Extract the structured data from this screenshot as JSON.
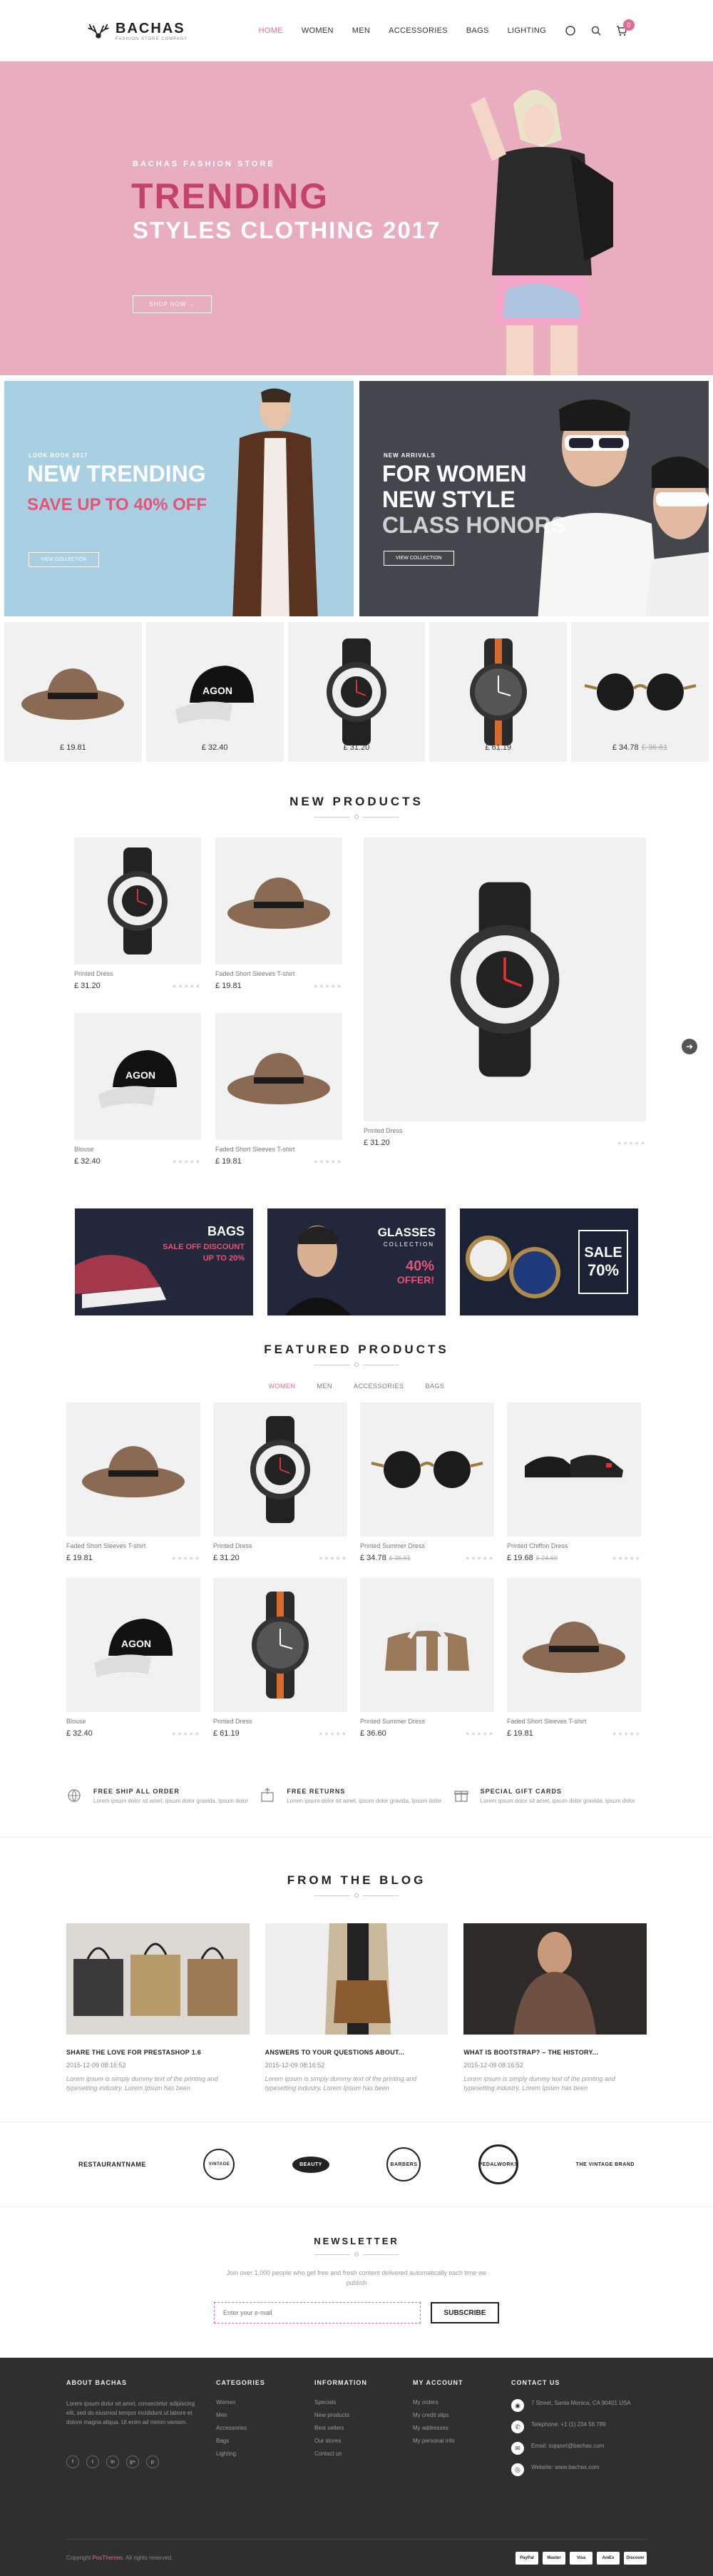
{
  "header": {
    "logo_name": "BACHAS",
    "logo_tag": "FASHION STORE COMPANY",
    "nav": [
      "HOME",
      "WOMEN",
      "MEN",
      "ACCESSORIES",
      "BAGS",
      "LIGHTING"
    ],
    "cart_count": "0"
  },
  "hero": {
    "kicker": "BACHAS FASHION STORE",
    "title": "TRENDING",
    "subtitle": "STYLES CLOTHING 2017",
    "button": "SHOP NOW →"
  },
  "banners": [
    {
      "kicker": "LOOK BOOK 2017",
      "title": "NEW TRENDING",
      "accent": "SAVE UP TO 40% OFF",
      "button": "VIEW COLLECTION"
    },
    {
      "kicker": "NEW ARRIVALS",
      "title": "FOR WOMEN",
      "lines": [
        "NEW STYLE",
        "CLASS HONORS"
      ],
      "button": "VIEW COLLECTION"
    }
  ],
  "strip": [
    {
      "type": "hat",
      "price": "£ 19.81",
      "old": ""
    },
    {
      "type": "cap",
      "price": "£ 32.40",
      "old": ""
    },
    {
      "type": "watch-red",
      "price": "£ 31.20",
      "old": ""
    },
    {
      "type": "watch-orange",
      "price": "£ 61.19",
      "old": ""
    },
    {
      "type": "sunglasses",
      "price": "£ 34.78",
      "old": "£ 36.61"
    }
  ],
  "new_products": {
    "title": "NEW PRODUCTS",
    "items": [
      {
        "name": "Printed Dress",
        "price": "£ 31.20",
        "type": "watch-red"
      },
      {
        "name": "Faded Short Sleeves T-shirt",
        "price": "£ 19.81",
        "type": "hat"
      },
      {
        "name": "Blouse",
        "price": "£ 32.40",
        "type": "cap"
      },
      {
        "name": "Faded Short Sleeves T-shirt",
        "price": "£ 19.81",
        "type": "hat"
      },
      {
        "name": "Printed Dress",
        "price": "£ 31.20",
        "type": "watch-red"
      }
    ]
  },
  "promos": [
    {
      "title": "BAGS",
      "line1": "SALE OFF DISCOUNT",
      "line2": "UP TO 20%"
    },
    {
      "title": "GLASSES",
      "sub": "COLLECTION",
      "percent": "40%",
      "offer": "OFFER!"
    },
    {
      "title": "SALE",
      "percent": "70%"
    }
  ],
  "featured": {
    "title": "FEATURED PRODUCTS",
    "tabs": [
      "WOMEN",
      "MEN",
      "ACCESSORIES",
      "BAGS"
    ],
    "items": [
      {
        "name": "Faded Short Sleeves T-shirt",
        "price": "£ 19.81",
        "old": "",
        "type": "hat"
      },
      {
        "name": "Printed Dress",
        "price": "£ 31.20",
        "old": "",
        "type": "watch-red"
      },
      {
        "name": "Printed Summer Dress",
        "price": "£ 34.78",
        "old": "£ 36.61",
        "type": "sunglasses"
      },
      {
        "name": "Printed Chiffon Dress",
        "price": "£ 19.68",
        "old": "£ 24.60",
        "type": "shoes"
      },
      {
        "name": "Blouse",
        "price": "£ 32.40",
        "old": "",
        "type": "cap"
      },
      {
        "name": "Printed Dress",
        "price": "£ 61.19",
        "old": "",
        "type": "watch-orange"
      },
      {
        "name": "Printed Summer Dress",
        "price": "£ 36.60",
        "old": "",
        "type": "bag"
      },
      {
        "name": "Faded Short Sleeves T-shirt",
        "price": "£ 19.81",
        "old": "",
        "type": "hat"
      }
    ]
  },
  "services": [
    {
      "title": "FREE SHIP ALL ORDER",
      "desc": "Lorem ipsum dolor sit amet, ipsum dolor gravida. Ipsum dolor"
    },
    {
      "title": "FREE RETURNS",
      "desc": "Lorem ipsum dolor sit amet, ipsum dolor gravida. Ipsum dolor"
    },
    {
      "title": "SPECIAL GIFT CARDS",
      "desc": "Lorem ipsum dolor sit amet, ipsum dolor gravida. Ipsum dolor"
    }
  ],
  "blog": {
    "title": "FROM THE BLOG",
    "posts": [
      {
        "title": "SHARE THE LOVE FOR PRESTASHOP 1.6",
        "date": "2015-12-09 08:16:52",
        "desc": "Lorem ipsum is simply dummy text of the printing and typesetting industry. Lorem Ipsum has been"
      },
      {
        "title": "ANSWERS TO YOUR QUESTIONS ABOUT...",
        "date": "2015-12-09 08:16:52",
        "desc": "Lorem ipsum is simply dummy text of the printing and typesetting industry. Lorem Ipsum has been"
      },
      {
        "title": "WHAT IS BOOTSTRAP? – THE HISTORY...",
        "date": "2015-12-09 08:16:52",
        "desc": "Lorem ipsum is simply dummy text of the printing and typesetting industry. Lorem Ipsum has been"
      }
    ]
  },
  "brands": [
    "RESTAURANTNAME",
    "VINTAGE",
    "BEAUTY",
    "BARBERS",
    "PEDALWORKS",
    "THE VINTAGE BRAND"
  ],
  "newsletter": {
    "title": "NEWSLETTER",
    "desc": "Join over 1,000 people who get free and fresh content delivered automatically each time we publish",
    "placeholder": "Enter your e-mail",
    "button": "SUBSCRIBE"
  },
  "footer": {
    "about_title": "ABOUT BACHAS",
    "about_text": "Lorem ipsum dolor sit amet, consectetur adipiscing elit, sed do eiusmod tempor incididunt ut labore et dolore magna aliqua. Ut enim ad minim veniam.",
    "social": [
      "f",
      "t",
      "in",
      "g+",
      "p"
    ],
    "categories_title": "CATEGORIES",
    "categories": [
      "Women",
      "Men",
      "Accessories",
      "Bags",
      "Lighting"
    ],
    "information_title": "INFORMATION",
    "information": [
      "Specials",
      "New products",
      "Best sellers",
      "Our stores",
      "Contact us"
    ],
    "account_title": "MY ACCOUNT",
    "account": [
      "My orders",
      "My credit slips",
      "My addresses",
      "My personal info"
    ],
    "contact_title": "CONTACT US",
    "contact": [
      {
        "icon": "map-icon",
        "text": "7 Street, Santa Monica, CA 90401 USA"
      },
      {
        "icon": "phone-icon",
        "text": "Telephone: +1 (1) 234 56 789"
      },
      {
        "icon": "mail-icon",
        "text": "Email: support@bachas.com"
      },
      {
        "icon": "web-icon",
        "text": "Website: www.bachas.com"
      }
    ],
    "copyright_pre": "Copyright ",
    "copyright_link": "PosThemes",
    "copyright_post": ". All rights reserved.",
    "payments": [
      "PayPal",
      "Master",
      "Visa",
      "AmEx",
      "Discover"
    ]
  }
}
